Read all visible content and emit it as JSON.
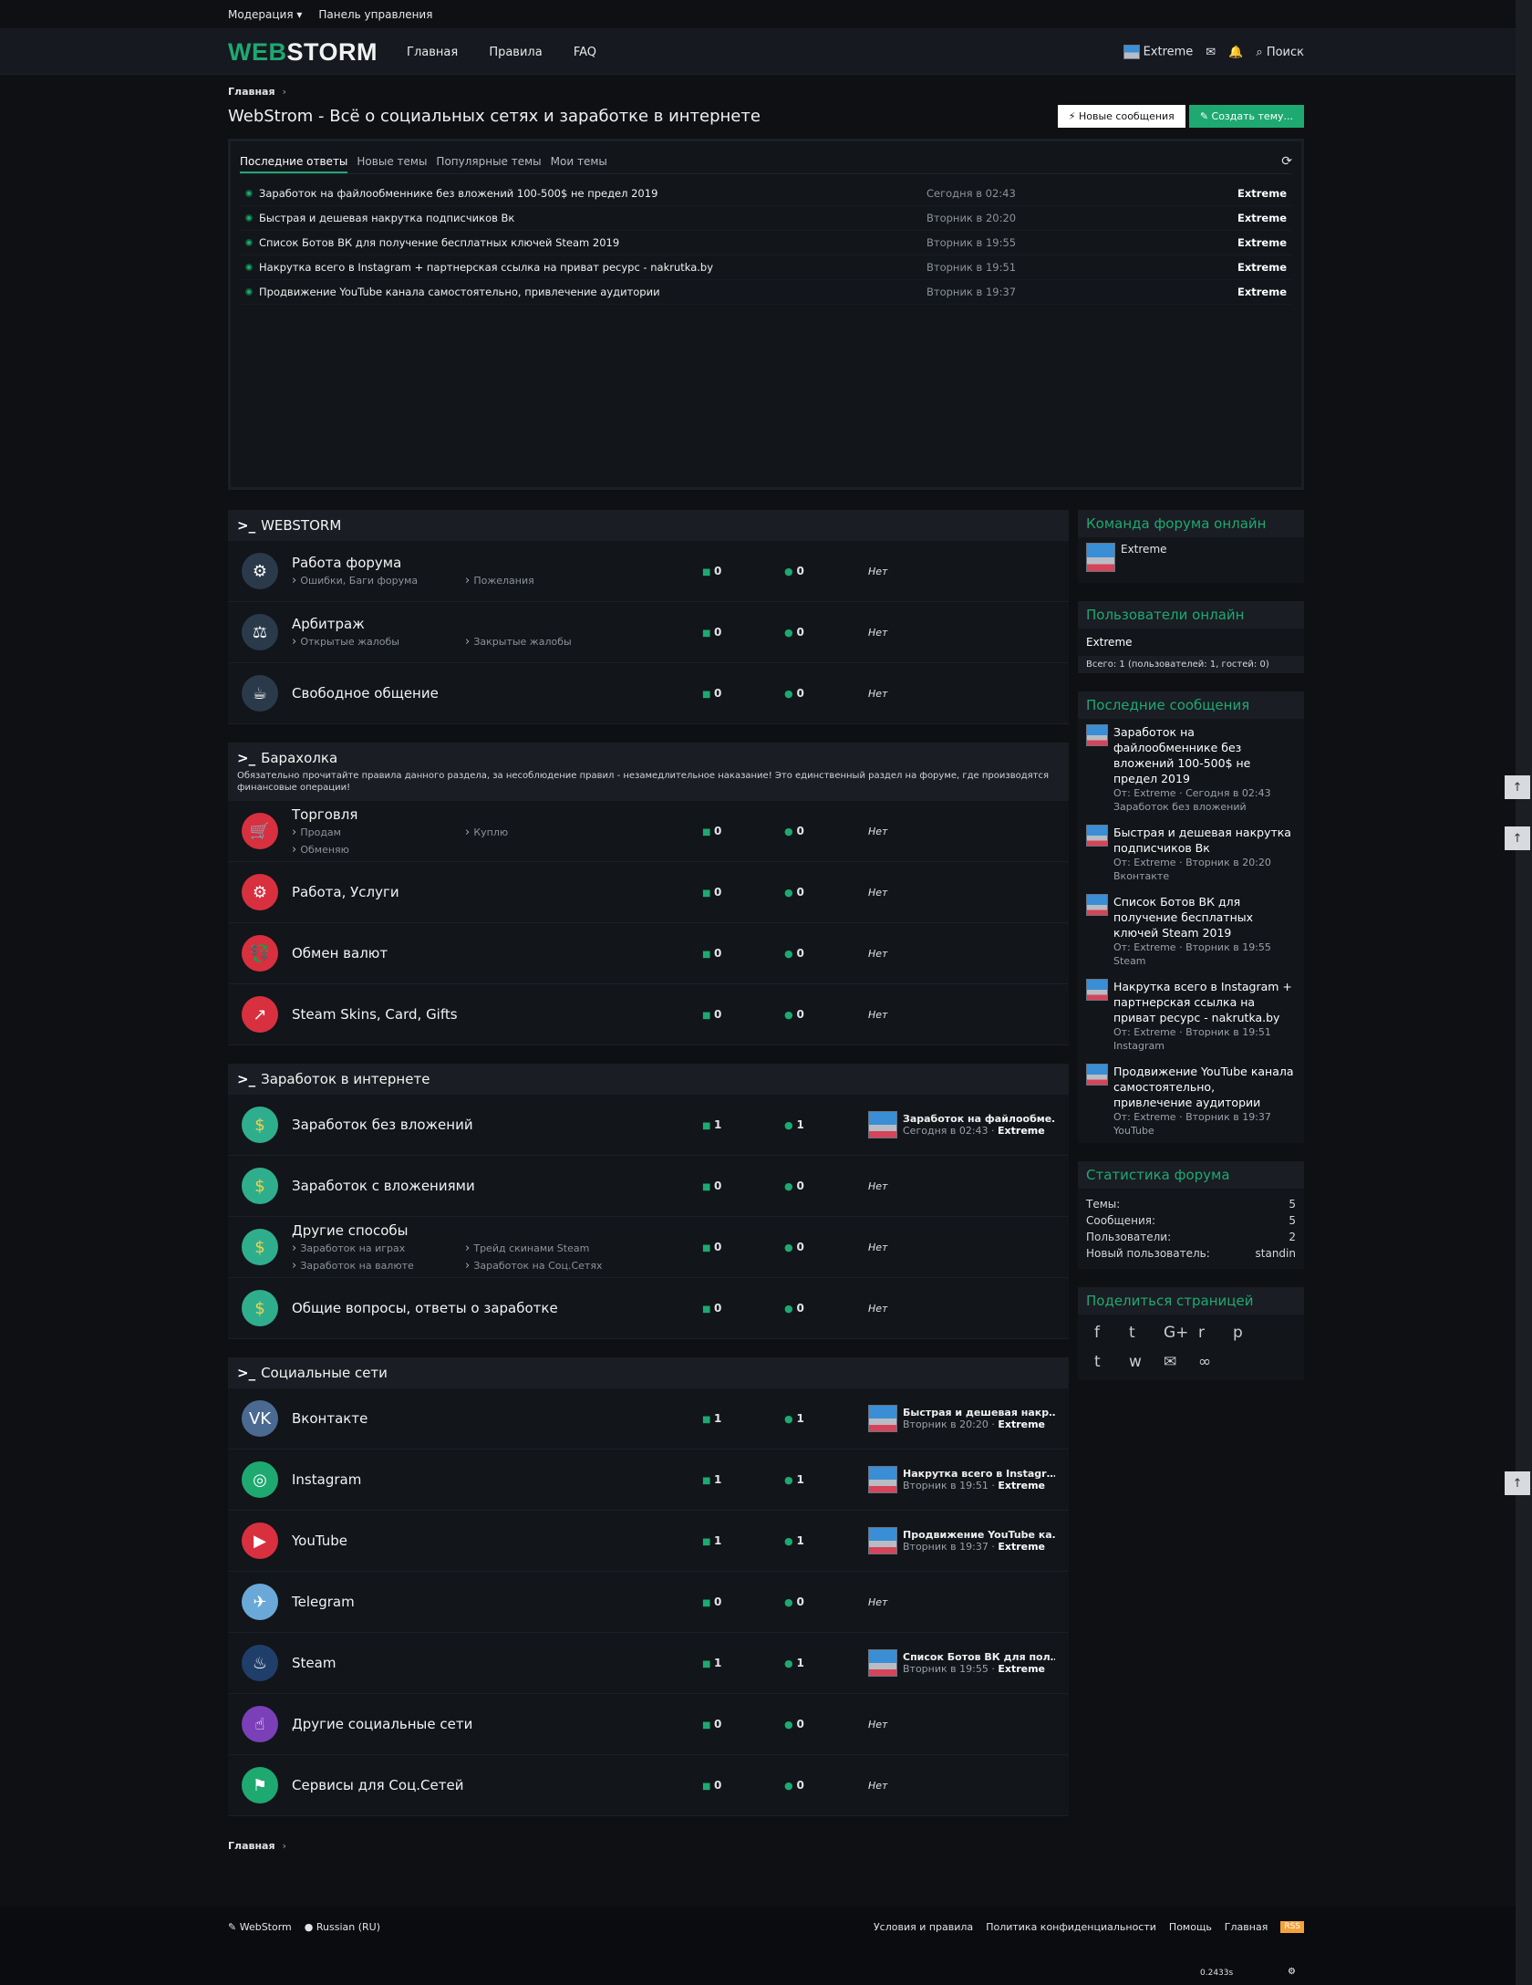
{
  "topbar": {
    "moderation": "Модерация ▾",
    "panel": "Панель управления"
  },
  "header": {
    "logo_a": "WEB",
    "logo_b": "STORM",
    "nav": [
      "Главная",
      "Правила",
      "FAQ"
    ],
    "user": "Extreme",
    "search": "Поиск"
  },
  "crumb": "Главная",
  "crumb_sep": "›",
  "title": "WebStrom - Всё о социальных сетях и заработке в интернете",
  "buttons": {
    "new_posts": "⚡ Новые сообщения",
    "create": "✎ Создать тему..."
  },
  "tabs": [
    "Последние ответы",
    "Новые темы",
    "Популярные темы",
    "Мои темы"
  ],
  "recent": [
    {
      "t": "Заработок на файлообменнике без вложений 100-500$ не предел 2019",
      "d": "Сегодня в 02:43",
      "u": "Extreme"
    },
    {
      "t": "Быстрая и дешевая накрутка подписчиков Вк",
      "d": "Вторник в 20:20",
      "u": "Extreme"
    },
    {
      "t": "Список Ботов ВК для получение бесплатных ключей Steam 2019",
      "d": "Вторник в 19:55",
      "u": "Extreme"
    },
    {
      "t": "Накрутка всего в Instagram + партнерская ссылка на приват ресурс - nakrutka.by",
      "d": "Вторник в 19:51",
      "u": "Extreme"
    },
    {
      "t": "Продвижение YouTube канала самостоятельно, привлечение аудитории",
      "d": "Вторник в 19:37",
      "u": "Extreme"
    }
  ],
  "nem": "Нет",
  "cats": [
    {
      "name": "WEBSTORM",
      "desc": "",
      "forums": [
        {
          "name": "Работа форума",
          "icon": "⚙",
          "bg": "#2a3a4a",
          "subs": [
            "Ошибки, Баги форума",
            "Пожелания"
          ],
          "t": "0",
          "m": "0"
        },
        {
          "name": "Арбитраж",
          "icon": "⚖",
          "bg": "#2a3a4a",
          "subs": [
            "Открытые жалобы",
            "Закрытые жалобы"
          ],
          "t": "0",
          "m": "0"
        },
        {
          "name": "Свободное общение",
          "icon": "☕",
          "bg": "#2a3a4a",
          "subs": [],
          "t": "0",
          "m": "0"
        }
      ]
    },
    {
      "name": "Барахолка",
      "desc": "Обязательно прочитайте правила данного раздела, за несоблюдение правил - незамедлительное наказание! Это единственный раздел на форуме, где производятся финансовые операции!",
      "forums": [
        {
          "name": "Торговля",
          "icon": "🛒",
          "bg": "#d8303f",
          "subs": [
            "Продам",
            "Куплю",
            "Обменяю"
          ],
          "t": "0",
          "m": "0"
        },
        {
          "name": "Работа, Услуги",
          "icon": "⚙",
          "bg": "#d8303f",
          "subs": [],
          "t": "0",
          "m": "0"
        },
        {
          "name": "Обмен валют",
          "icon": "💱",
          "bg": "#d8303f",
          "subs": [],
          "t": "0",
          "m": "0"
        },
        {
          "name": "Steam Skins, Card, Gifts",
          "icon": "↗",
          "bg": "#d8303f",
          "subs": [],
          "t": "0",
          "m": "0"
        }
      ]
    },
    {
      "name": "Заработок в интернете",
      "desc": "",
      "forums": [
        {
          "name": "Заработок без вложений",
          "icon": "$",
          "bg": "#2fae8e",
          "subs": [],
          "t": "1",
          "m": "1",
          "last": {
            "title": "Заработок на файлообменнике без вложений",
            "date": "Сегодня в 02:43 · ",
            "user": "Extreme"
          }
        },
        {
          "name": "Заработок с вложениями",
          "icon": "$",
          "bg": "#2fae8e",
          "subs": [],
          "t": "0",
          "m": "0"
        },
        {
          "name": "Другие способы",
          "icon": "$",
          "bg": "#2fae8e",
          "subs": [
            "Заработок на играх",
            "Трейд скинами Steam",
            "Заработок на валюте",
            "Заработок на Соц.Сетях"
          ],
          "t": "0",
          "m": "0"
        },
        {
          "name": "Общие вопросы, ответы о заработке",
          "icon": "$",
          "bg": "#2fae8e",
          "subs": [],
          "t": "0",
          "m": "0"
        }
      ]
    },
    {
      "name": "Социальные сети",
      "desc": "",
      "forums": [
        {
          "name": "Вконтакте",
          "icon": "VK",
          "bg": "#4a6a92",
          "subs": [],
          "t": "1",
          "m": "1",
          "last": {
            "title": "Быстрая и дешевая накрутка подписчиков Вк",
            "date": "Вторник в 20:20 · ",
            "user": "Extreme"
          }
        },
        {
          "name": "Instagram",
          "icon": "◎",
          "bg": "#1ea971",
          "subs": [],
          "t": "1",
          "m": "1",
          "last": {
            "title": "Накрутка всего в Instagram + партнерская",
            "date": "Вторник в 19:51 · ",
            "user": "Extreme"
          }
        },
        {
          "name": "YouTube",
          "icon": "▶",
          "bg": "#d8303f",
          "subs": [],
          "t": "1",
          "m": "1",
          "last": {
            "title": "Продвижение YouTube канала самостоятельно",
            "date": "Вторник в 19:37 · ",
            "user": "Extreme"
          }
        },
        {
          "name": "Telegram",
          "icon": "✈",
          "bg": "#6aa8d8",
          "subs": [],
          "t": "0",
          "m": "0"
        },
        {
          "name": "Steam",
          "icon": "♨",
          "bg": "#1f3f6a",
          "subs": [],
          "t": "1",
          "m": "1",
          "last": {
            "title": "Список Ботов ВК для получение бесплатных",
            "date": "Вторник в 19:55 · ",
            "user": "Extreme"
          }
        },
        {
          "name": "Другие социальные сети",
          "icon": "☝",
          "bg": "#7b3fb8",
          "subs": [],
          "t": "0",
          "m": "0"
        },
        {
          "name": "Сервисы для Соц.Сетей",
          "icon": "⚑",
          "bg": "#1ea971",
          "subs": [],
          "t": "0",
          "m": "0"
        }
      ]
    }
  ],
  "side": {
    "team_head": "Команда форума онлайн",
    "team_user": "Extreme",
    "online_head": "Пользователи онлайн",
    "online_user": "Extreme",
    "online_total": "Всего: 1 (пользователей: 1, гостей: 0)",
    "msgs_head": "Последние сообщения",
    "msgs": [
      {
        "t": "Заработок на файлообменнике без вложений 100-500$ не предел 2019",
        "m": "От: Extreme · Сегодня в 02:43",
        "f": "Заработок без вложений"
      },
      {
        "t": "Быстрая и дешевая накрутка подписчиков Вк",
        "m": "От: Extreme · Вторник в 20:20",
        "f": "Вконтакте"
      },
      {
        "t": "Список Ботов ВК для получение бесплатных ключей Steam 2019",
        "m": "От: Extreme · Вторник в 19:55",
        "f": "Steam"
      },
      {
        "t": "Накрутка всего в Instagram + партнерская ссылка на приват ресурс - nakrutka.by",
        "m": "От: Extreme · Вторник в 19:51",
        "f": "Instagram"
      },
      {
        "t": "Продвижение YouTube канала самостоятельно, привлечение аудитории",
        "m": "От: Extreme · Вторник в 19:37",
        "f": "YouTube"
      }
    ],
    "stats_head": "Статистика форума",
    "stats": [
      [
        "Темы:",
        "5"
      ],
      [
        "Сообщения:",
        "5"
      ],
      [
        "Пользователи:",
        "2"
      ],
      [
        "Новый пользователь:",
        "standin"
      ]
    ],
    "share_head": "Поделиться страницей",
    "share": [
      "f",
      "t",
      "G+",
      "r",
      "p",
      "t",
      "w",
      "✉",
      "∞"
    ]
  },
  "footer": {
    "crumb": "Главная",
    "brand": "✎ WebStorm",
    "lang": "● Russian (RU)",
    "links": [
      "Условия и правила",
      "Политика конфиденциальности",
      "Помощь",
      "Главная"
    ],
    "rss": "RSS",
    "time": "0.2433s"
  }
}
